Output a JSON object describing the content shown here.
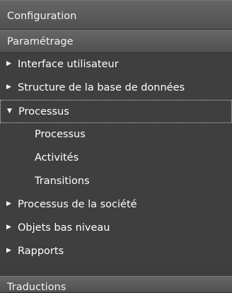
{
  "sections": {
    "configuration": "Configuration",
    "parametrage": "Paramétrage",
    "traductions": "Traductions"
  },
  "tree": {
    "items": [
      {
        "label": "Interface utilisateur",
        "icon": "chevron-right-icon"
      },
      {
        "label": "Structure de la base de données",
        "icon": "chevron-right-icon"
      },
      {
        "label": "Processus",
        "icon": "chevron-down-icon"
      },
      {
        "label": "Processus"
      },
      {
        "label": "Activités"
      },
      {
        "label": "Transitions"
      },
      {
        "label": "Processus de la société",
        "icon": "chevron-right-icon"
      },
      {
        "label": "Objets bas niveau",
        "icon": "chevron-right-icon"
      },
      {
        "label": "Rapports",
        "icon": "chevron-right-icon"
      }
    ]
  },
  "colors": {
    "background": "#3f3f3f",
    "header": "#5a5a5a",
    "text": "#ffffff"
  }
}
